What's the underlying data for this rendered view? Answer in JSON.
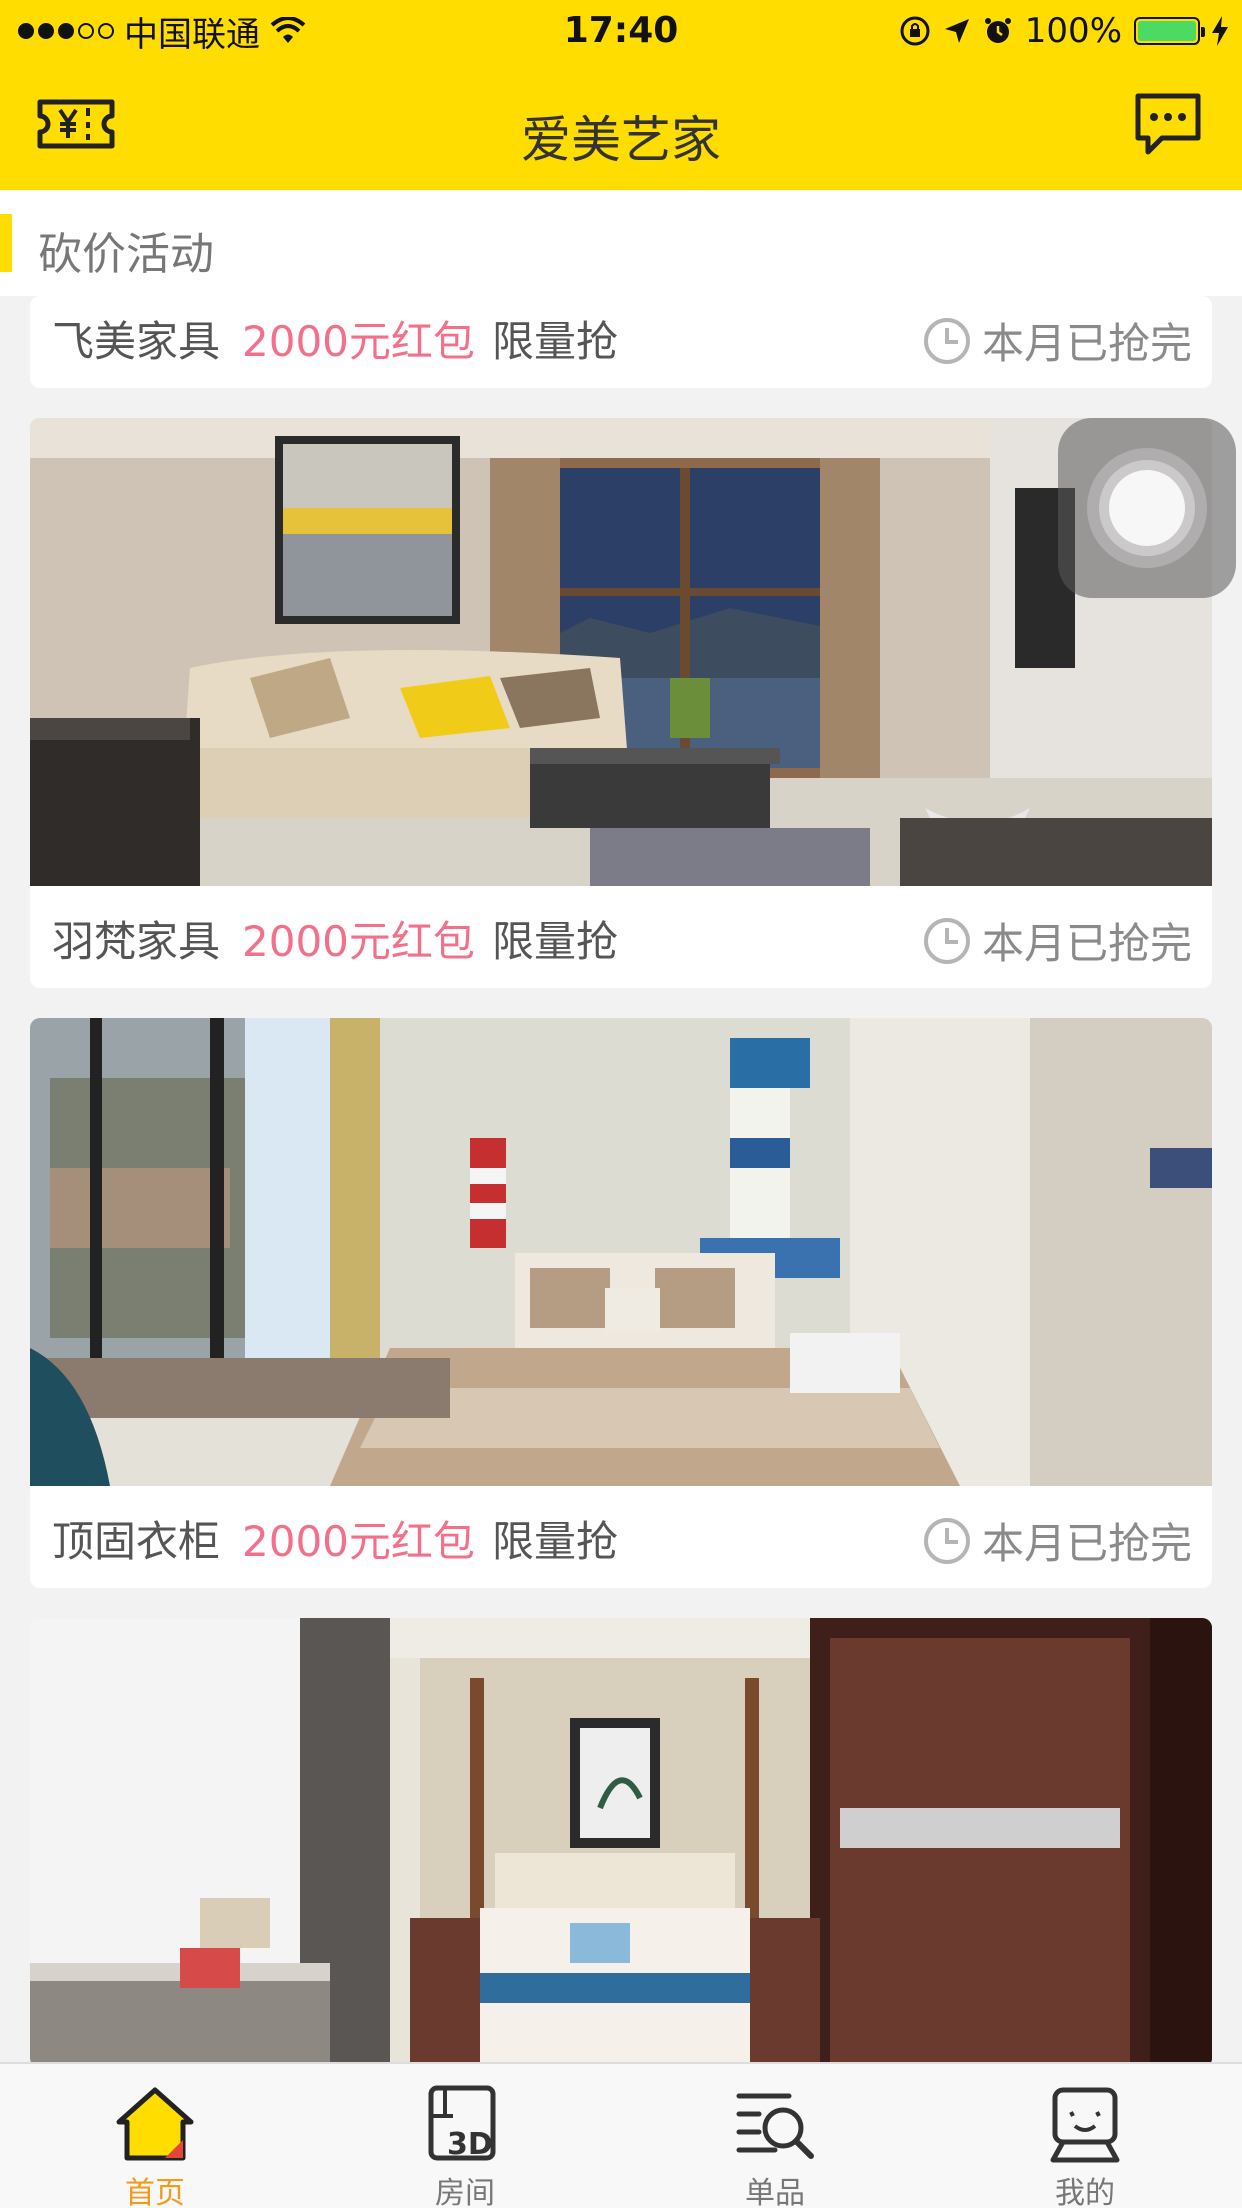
{
  "status_bar": {
    "carrier": "中国联通",
    "time": "17:40",
    "battery": "100%"
  },
  "nav": {
    "title": "爱美艺家",
    "left_icon": "coupon-icon",
    "right_icon": "message-icon"
  },
  "section": {
    "title": "砍价活动"
  },
  "deals": [
    {
      "brand": "飞美家具",
      "price": "2000元红包",
      "tag": "限量抢",
      "status": "本月已抢完"
    },
    {
      "brand": "羽梵家具",
      "price": "2000元红包",
      "tag": "限量抢",
      "status": "本月已抢完"
    },
    {
      "brand": "顶固衣柜",
      "price": "2000元红包",
      "tag": "限量抢",
      "status": "本月已抢完"
    }
  ],
  "tabs": [
    {
      "label": "首页",
      "icon": "home-icon",
      "active": true
    },
    {
      "label": "房间",
      "icon": "room-3d-icon",
      "active": false
    },
    {
      "label": "单品",
      "icon": "product-search-icon",
      "active": false
    },
    {
      "label": "我的",
      "icon": "profile-icon",
      "active": false
    }
  ],
  "colors": {
    "brand_yellow": "#FFDD00",
    "price_pink": "#f2708a",
    "tab_active": "#f29a1a",
    "page_bg": "#f2f2f2"
  }
}
